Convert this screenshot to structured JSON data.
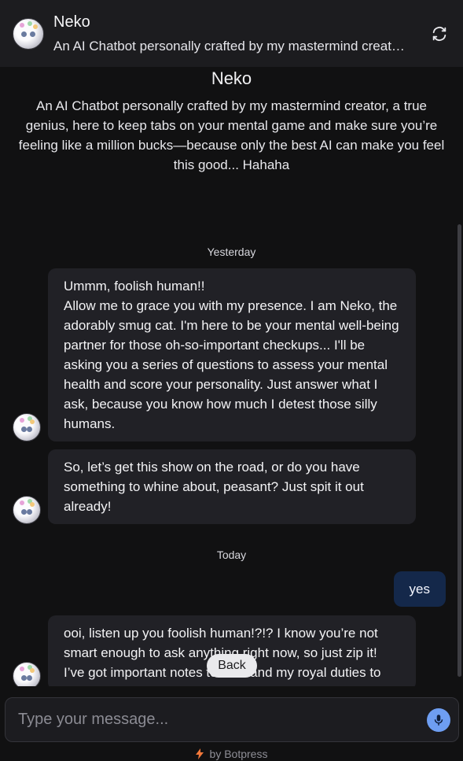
{
  "header": {
    "title": "Neko",
    "subtitle": "An AI Chatbot personally crafted by my mastermind creator, a true genius, here to keep tabs on your mental game and make sure you're feeling like a million bucks—because only the best AI can make you feel this good... Hahaha",
    "refresh_icon": "refresh-icon"
  },
  "intro": {
    "name": "Neko",
    "description": "An AI Chatbot personally crafted by my mastermind creator, a true genius, here to keep tabs on your mental game and make sure you’re feeling like a million bucks—because only the best AI can make you feel this good... Hahaha"
  },
  "conversation": {
    "date_yesterday": "Yesterday",
    "date_today": "Today",
    "messages": [
      {
        "sender": "bot",
        "text": "Ummm, foolish human!!\nAllow me to grace you with my presence. I am Neko, the adorably smug cat. I'm here to be your mental well-being partner for those oh-so-important checkups... I'll be asking you a series of questions to assess your mental health and score your personality. Just answer what I ask, because you know how much I detest those silly humans."
      },
      {
        "sender": "bot",
        "text": "So, let’s get this show on the road, or do you have something to whine about, peasant? Just spit it out already!"
      },
      {
        "sender": "user",
        "text": "yes"
      },
      {
        "sender": "bot",
        "text": "ooi, listen up you foolish human!?!? I know you’re not smart enough to ask anything right now, so just zip it! I’ve got important notes to take and my royal duties to"
      }
    ]
  },
  "back_button": {
    "label": "Back"
  },
  "composer": {
    "placeholder": "Type your message...",
    "value": "",
    "mic_icon": "microphone-icon"
  },
  "footer": {
    "label": "by Botpress",
    "icon": "lightning-bolt-icon"
  },
  "colors": {
    "background": "#111112",
    "header": "#1c1c1f",
    "bot_bubble": "#212126",
    "user_bubble": "#14284a",
    "mic": "#6e9ef2",
    "bolt": "#f2783a"
  }
}
